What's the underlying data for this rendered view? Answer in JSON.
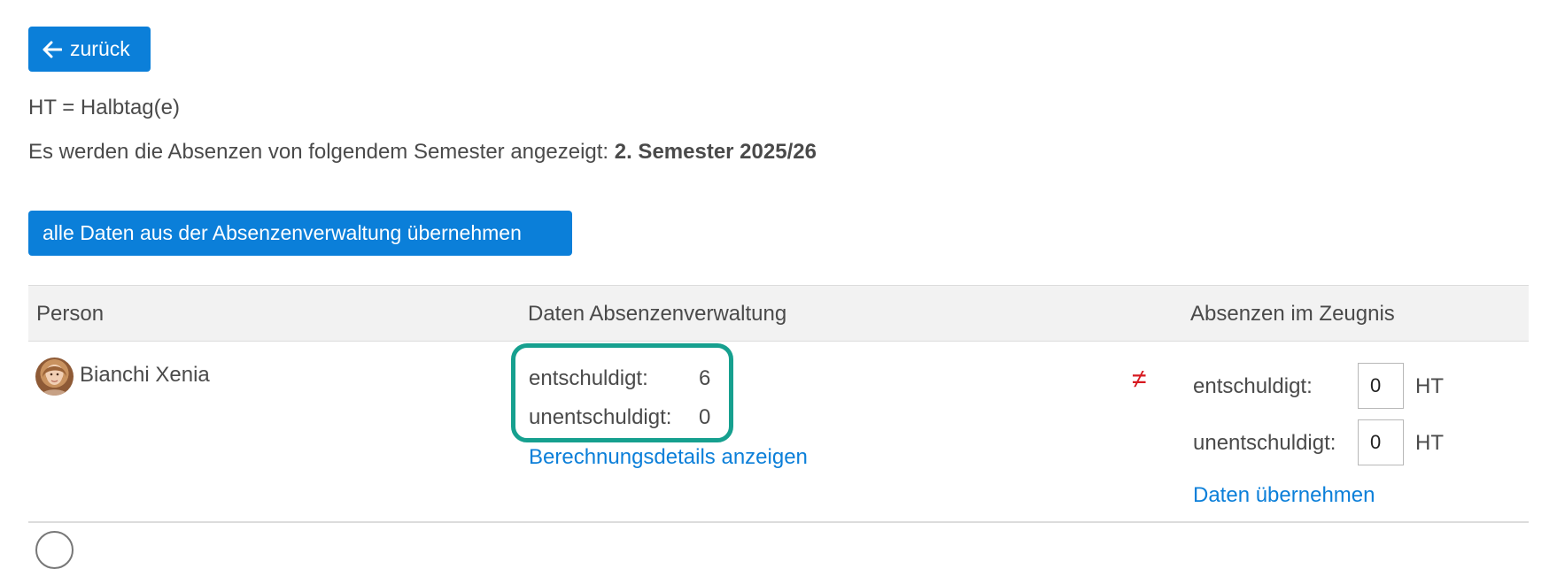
{
  "toolbar": {
    "back_label": "zurück",
    "back_icon": "arrow-left-icon"
  },
  "info": {
    "legend": "HT = Halbtag(e)",
    "semester_prefix": "Es werden die Absenzen von folgendem Semester angezeigt: ",
    "semester_value": "2. Semester 2025/26"
  },
  "actions": {
    "take_all_label": "alle Daten aus der Absenzenverwaltung übernehmen"
  },
  "table": {
    "headers": {
      "person": "Person",
      "daten": "Daten Absenzenverwaltung",
      "zeugnis": "Absenzen im Zeugnis"
    },
    "rows": [
      {
        "person": "Bianchi Xenia",
        "daten": {
          "entschuldigt_label": "entschuldigt:",
          "entschuldigt_value": "6",
          "unentschuldigt_label": "unentschuldigt:",
          "unentschuldigt_value": "0",
          "details_link": "Berechnungsdetails anzeigen"
        },
        "mismatch_symbol": "≠",
        "zeugnis": {
          "entschuldigt_label": "entschuldigt:",
          "entschuldigt_value": "0",
          "unentschuldigt_label": "unentschuldigt:",
          "unentschuldigt_value": "0",
          "unit": "HT",
          "apply_link": "Daten übernehmen"
        }
      }
    ]
  },
  "colors": {
    "primary": "#0b7fd9",
    "highlight": "#16a08f",
    "mismatch": "#d71920",
    "header_bg": "#f2f2f2",
    "text": "#4a4a4a"
  }
}
